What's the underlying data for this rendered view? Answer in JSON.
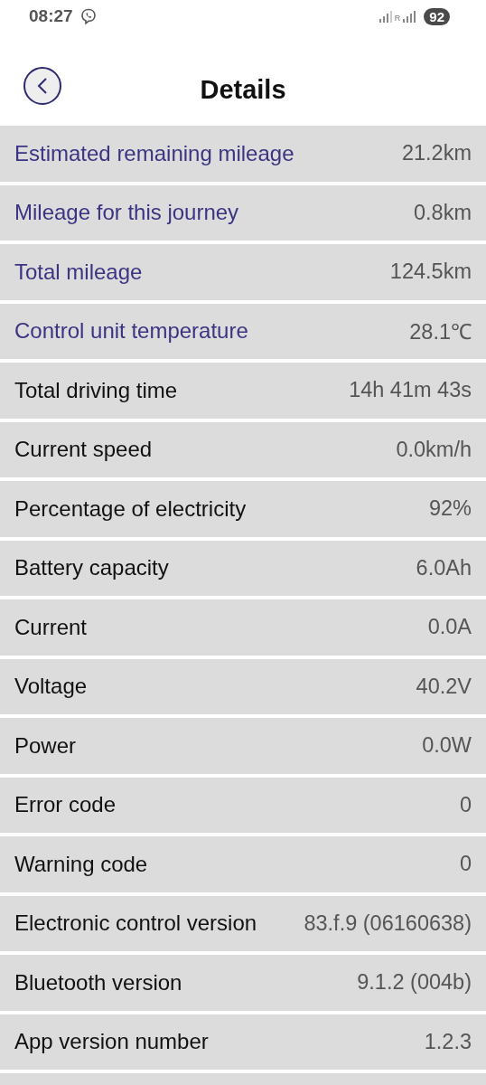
{
  "status_bar": {
    "time": "08:27",
    "network_label": "R",
    "battery": "92"
  },
  "header": {
    "title": "Details"
  },
  "rows": [
    {
      "label": "Estimated remaining mileage",
      "value": "21.2km",
      "color": "#3b3482"
    },
    {
      "label": "Mileage for this journey",
      "value": "0.8km",
      "color": "#3b3482"
    },
    {
      "label": "Total mileage",
      "value": "124.5km",
      "color": "#3b3482"
    },
    {
      "label": "Control unit temperature",
      "value": "28.1℃",
      "color": "#3b3482"
    },
    {
      "label": "Total driving time",
      "value": "14h 41m 43s",
      "color": "#111111"
    },
    {
      "label": "Current speed",
      "value": "0.0km/h",
      "color": "#111111"
    },
    {
      "label": "Percentage of electricity",
      "value": "92%",
      "color": "#111111"
    },
    {
      "label": "Battery capacity",
      "value": "6.0Ah",
      "color": "#111111"
    },
    {
      "label": "Current",
      "value": "0.0A",
      "color": "#111111"
    },
    {
      "label": "Voltage",
      "value": "40.2V",
      "color": "#111111"
    },
    {
      "label": "Power",
      "value": "0.0W",
      "color": "#111111"
    },
    {
      "label": "Error code",
      "value": "0",
      "color": "#111111"
    },
    {
      "label": "Warning code",
      "value": "0",
      "color": "#111111"
    },
    {
      "label": "Electronic control version",
      "value": "83.f.9 (06160638)",
      "color": "#111111"
    },
    {
      "label": "Bluetooth version",
      "value": "9.1.2 (004b)",
      "color": "#111111"
    },
    {
      "label": "App version number",
      "value": "1.2.3",
      "color": "#111111"
    }
  ]
}
